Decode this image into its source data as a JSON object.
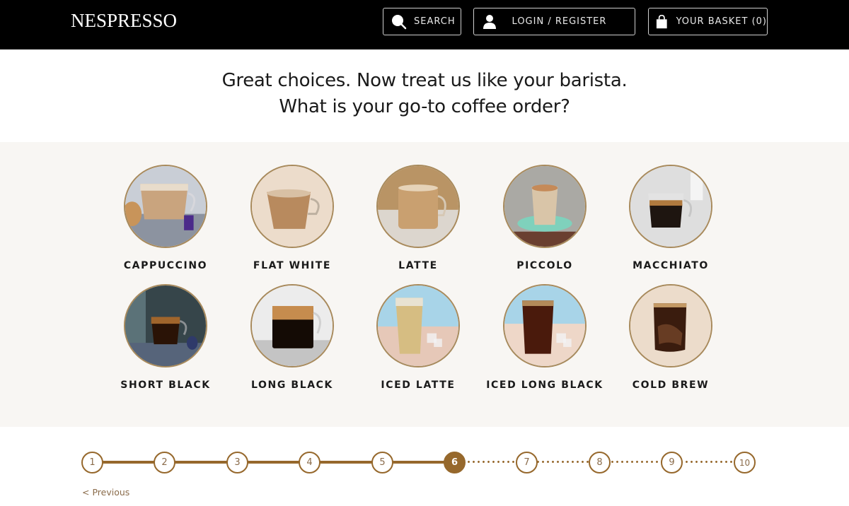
{
  "header": {
    "brand": "NESPRESSO",
    "search_label": "SEARCH",
    "login_label": "LOGIN / REGISTER",
    "basket_label": "YOUR BASKET (0)",
    "search_icon": "search-icon",
    "user_icon": "user-icon",
    "bag_icon": "shopping-bag-icon"
  },
  "question": {
    "line1": "Great choices. Now treat us like your barista.",
    "line2": "What is your go-to coffee order?"
  },
  "options": [
    {
      "label": "CAPPUCCINO",
      "image": "cappuccino-glass-cup"
    },
    {
      "label": "FLAT WHITE",
      "image": "flat-white-glass-cup"
    },
    {
      "label": "LATTE",
      "image": "latte-glass-mug"
    },
    {
      "label": "PICCOLO",
      "image": "piccolo-glass-on-mint-saucer"
    },
    {
      "label": "MACCHIATO",
      "image": "macchiato-glass-cup"
    },
    {
      "label": "SHORT BLACK",
      "image": "short-black-espresso-cup"
    },
    {
      "label": "LONG BLACK",
      "image": "long-black-glass-mug"
    },
    {
      "label": "ICED LATTE",
      "image": "iced-latte-glass"
    },
    {
      "label": "ICED LONG BLACK",
      "image": "iced-long-black-glass"
    },
    {
      "label": "COLD BREW",
      "image": "cold-brew-glass"
    }
  ],
  "progress": {
    "current_step": 6,
    "total_steps": 10,
    "steps": [
      "1",
      "2",
      "3",
      "4",
      "5",
      "6",
      "7",
      "8",
      "9",
      "10"
    ]
  },
  "nav": {
    "previous_label": "< Previous"
  },
  "colors": {
    "accent": "#96682c",
    "panel_bg": "#f8f6f3",
    "header_bg": "#000000"
  }
}
